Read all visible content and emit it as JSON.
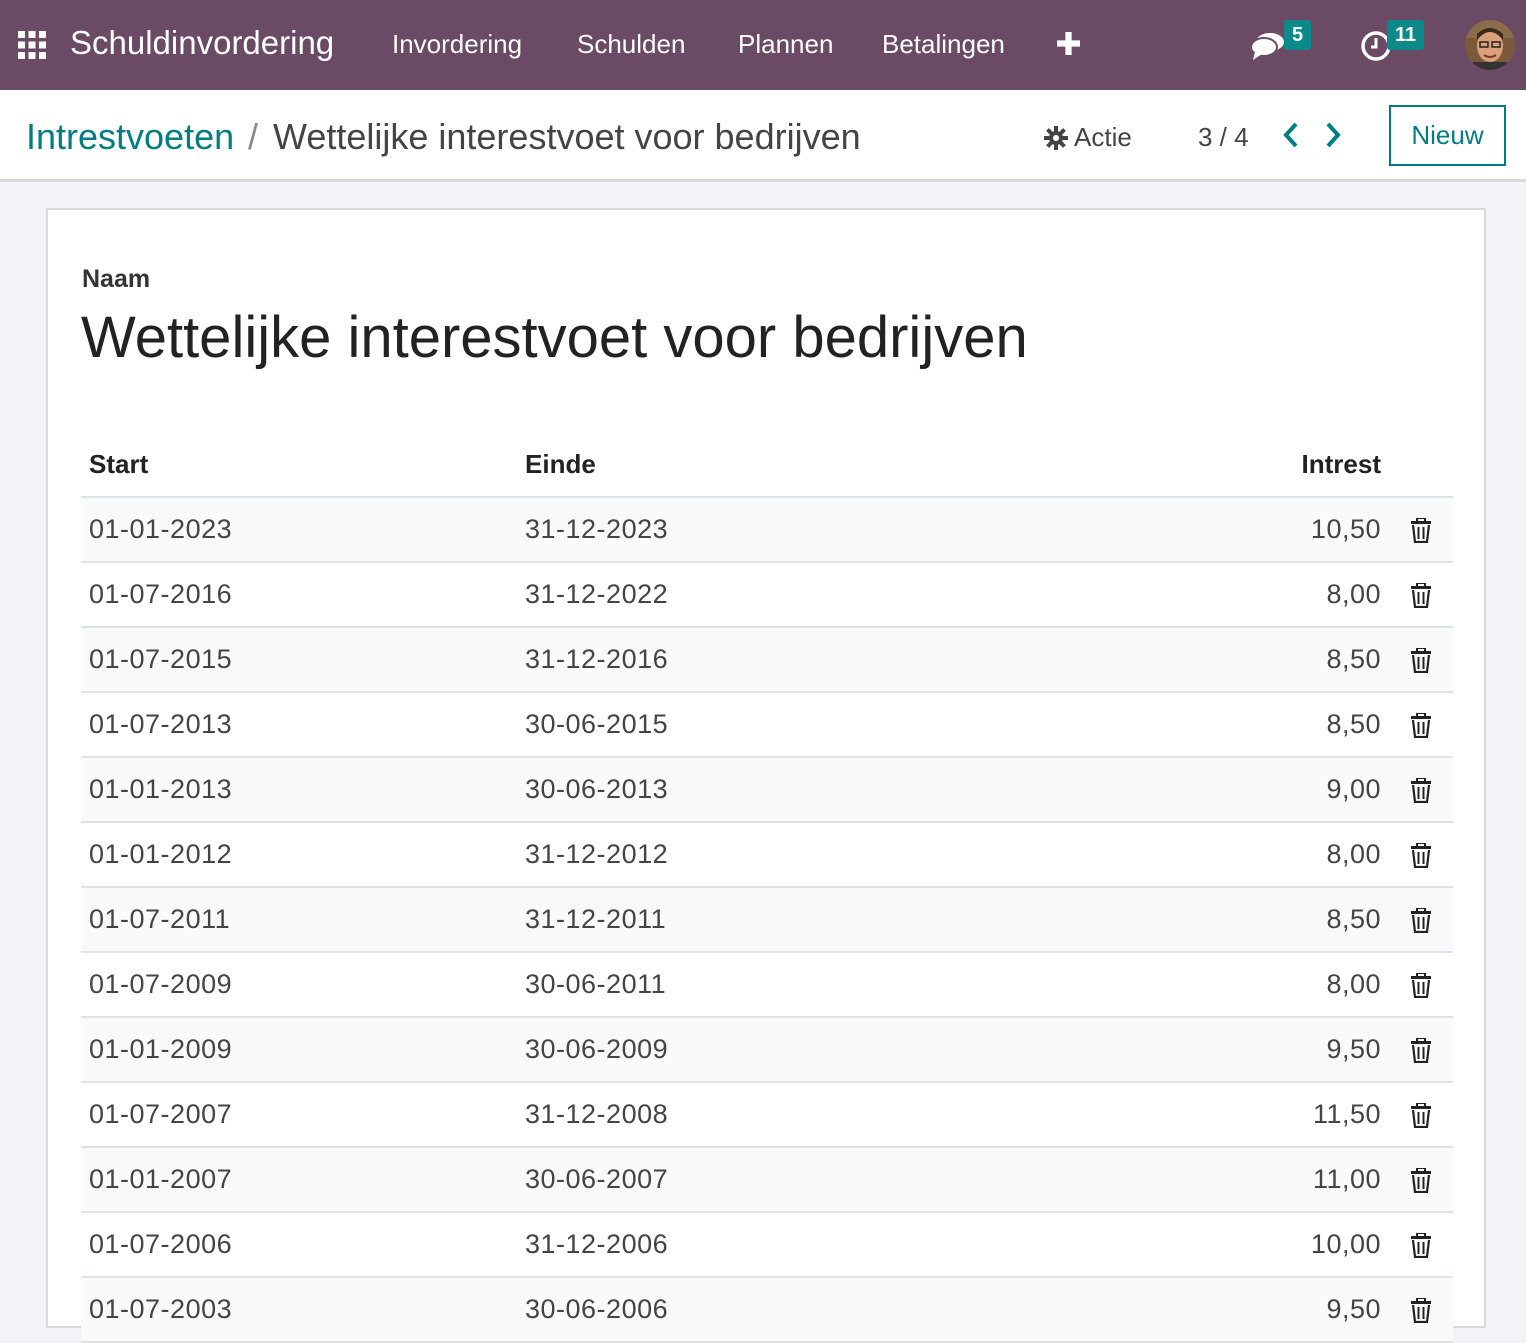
{
  "navbar": {
    "app_title": "Schuldinvordering",
    "menu": [
      "Invordering",
      "Schulden",
      "Plannen",
      "Betalingen"
    ],
    "messages_count": "5",
    "activities_count": "11",
    "icons": [
      "apps-grid-icon",
      "plus-icon",
      "chat-icon",
      "clock-icon"
    ]
  },
  "control_panel": {
    "breadcrumb_parent": "Intrestvoeten",
    "breadcrumb_separator": "/",
    "breadcrumb_current": "Wettelijke interestvoet voor bedrijven",
    "action_label": "Actie",
    "pager": "3 / 4",
    "new_label": "Nieuw"
  },
  "form": {
    "name_label": "Naam",
    "name_value": "Wettelijke interestvoet voor bedrijven",
    "table": {
      "headers": [
        "Start",
        "Einde",
        "Intrest"
      ],
      "rows": [
        [
          "01-01-2023",
          "31-12-2023",
          "10,50"
        ],
        [
          "01-07-2016",
          "31-12-2022",
          "8,00"
        ],
        [
          "01-07-2015",
          "31-12-2016",
          "8,50"
        ],
        [
          "01-07-2013",
          "30-06-2015",
          "8,50"
        ],
        [
          "01-01-2013",
          "30-06-2013",
          "9,00"
        ],
        [
          "01-01-2012",
          "31-12-2012",
          "8,00"
        ],
        [
          "01-07-2011",
          "31-12-2011",
          "8,50"
        ],
        [
          "01-07-2009",
          "30-06-2011",
          "8,00"
        ],
        [
          "01-01-2009",
          "30-06-2009",
          "9,50"
        ],
        [
          "01-07-2007",
          "31-12-2008",
          "11,50"
        ],
        [
          "01-01-2007",
          "30-06-2007",
          "11,00"
        ],
        [
          "01-07-2006",
          "31-12-2006",
          "10,00"
        ],
        [
          "01-07-2003",
          "30-06-2006",
          "9,50"
        ]
      ]
    }
  },
  "colors": {
    "navbar_bg": "#6b4a66",
    "accent": "#017e84",
    "badge": "#0c8a8a"
  }
}
